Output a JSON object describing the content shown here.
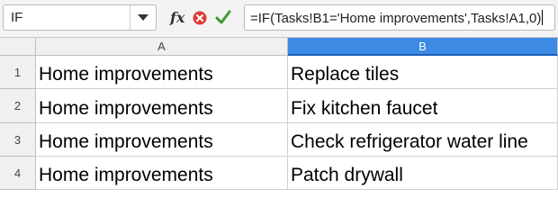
{
  "formula_bar": {
    "name_box_value": "IF",
    "function_wizard_label": "fx",
    "formula": "=IF(Tasks!B1='Home improvements',Tasks!A1,0)"
  },
  "columns": [
    {
      "label": "A",
      "selected": false
    },
    {
      "label": "B",
      "selected": true
    }
  ],
  "rows": [
    {
      "number": "1",
      "a": "Home improvements",
      "b": "Replace tiles"
    },
    {
      "number": "2",
      "a": "Home improvements",
      "b": "Fix kitchen faucet"
    },
    {
      "number": "3",
      "a": "Home improvements",
      "b": "Check refrigerator water line"
    },
    {
      "number": "4",
      "a": "Home improvements",
      "b": "Patch drywall"
    }
  ],
  "colors": {
    "cancel_red": "#e03a3a",
    "accept_green": "#3f9b2e",
    "selected_header": "#3c8ae3"
  }
}
